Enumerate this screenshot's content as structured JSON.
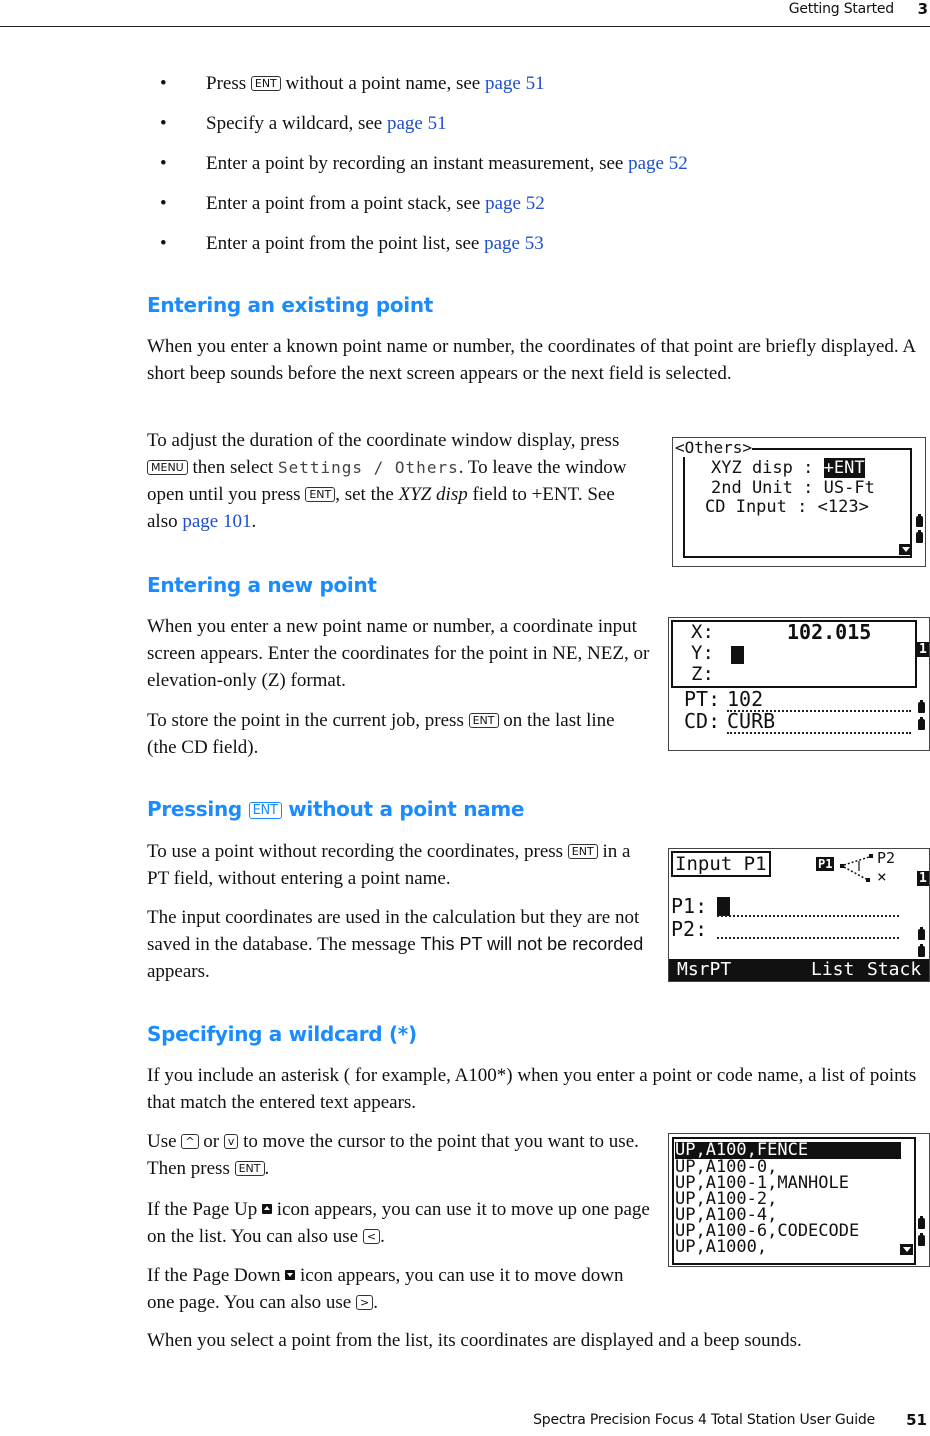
{
  "header": {
    "section": "Getting Started",
    "chapter": "3"
  },
  "footer": {
    "title": "Spectra Precision Focus 4 Total Station User Guide",
    "page": "51"
  },
  "bullets": [
    {
      "pre": "Press ",
      "key": "ENT",
      "post": " without a point name, see ",
      "link": "page 51"
    },
    {
      "pre": "Specify a wildcard, see ",
      "link": "page 51"
    },
    {
      "pre": "Enter a point by recording an instant measurement, see ",
      "link": "page 52"
    },
    {
      "pre": "Enter a point from a point stack, see ",
      "link": "page 52"
    },
    {
      "pre": "Enter a point from the point list, see ",
      "link": "page 53"
    }
  ],
  "sec1": {
    "heading": "Entering an existing point",
    "para1": "When you enter a known point name or number, the coordinates of that point are briefly displayed. A short beep sounds before the next screen appears or the next field is selected.",
    "para2_a": "To adjust the duration of the coordinate window display, press ",
    "key_menu": "MENU",
    "para2_b": " then select ",
    "menu_path": "Settings / Others",
    "para2_c": ". To leave the window open until you press ",
    "key_ent": "ENT",
    "para2_d": ", set the ",
    "field_name": "XYZ disp",
    "para2_e": " field to +ENT. See also ",
    "link": "page 101",
    "para2_f": ".",
    "screen": {
      "title": "<Others>",
      "rows": [
        {
          "label": "XYZ disp",
          "sep": ":",
          "value": "+ENT"
        },
        {
          "label": "2nd Unit",
          "sep": ":",
          "value": "US-Ft"
        },
        {
          "label": "CD Input",
          "sep": ":",
          "value": "<123>"
        }
      ]
    }
  },
  "sec2": {
    "heading": "Entering a new point",
    "para1": "When you enter a new point name or number, a coordinate input screen appears. Enter the coordinates for the point in NE, NEZ, or elevation-only (Z) format.",
    "para2_a": "To store the point in the current job, press ",
    "key": "ENT",
    "para2_b": " on the last line (the CD field).",
    "screen": {
      "x_label": "X:",
      "x_value": "102.015",
      "y_label": "Y:",
      "z_label": "Z:",
      "pt_label": "PT:",
      "pt_value": "102",
      "cd_label": "CD:",
      "cd_value": "CURB",
      "page_badge": "1"
    }
  },
  "sec3": {
    "heading_a": "Pressing ",
    "heading_key": "ENT",
    "heading_b": " without a point name",
    "para1_key": "ENT",
    "para1_a": "To use a point without recording the coordinates, press ",
    "para1_b": " in a PT field, without entering a point name.",
    "para2_a": "The input coordinates are used in the calculation but they are not saved in the database. The message ",
    "message": "This PT will not be recorded",
    "para2_b": " appears.",
    "screen": {
      "title": "Input P1",
      "diagram_p1": "P1",
      "diagram_p2": "P2",
      "diagram_x": "×",
      "page_badge": "1",
      "p1_label": "P1:",
      "p2_label": "P2:",
      "softkeys": [
        "MsrPT",
        "List",
        "Stack"
      ]
    }
  },
  "sec4": {
    "heading": "Specifying a wildcard (*)",
    "para1": "If you include an asterisk ( for example, A100*) when you enter a point or code name, a list of points that match the entered text appears.",
    "para2_a": "Use ",
    "key_up": "^",
    "para2_b": " or ",
    "key_down": "v",
    "para2_c": " to move the cursor to the point that you want to use. Then press ",
    "key_ent": "ENT",
    "para2_d": ".",
    "para3_a": "If the Page Up ",
    "para3_b": " icon appears, you can use it to move up one page on the list. You can also use ",
    "key_left": "<",
    "para3_c": ".",
    "para4_a": "If the Page Down ",
    "para4_b": " icon appears, you can use it to move down one page. You can also use ",
    "key_right": ">",
    "para4_c": ".",
    "para5": "When you select a point from the list, its coordinates are displayed and a beep sounds.",
    "screen": {
      "rows": [
        "UP,A100,FENCE",
        "UP,A100-0,",
        "UP,A100-1,MANHOLE",
        "UP,A100-2,",
        "UP,A100-4,",
        "UP,A100-6,CODECODE",
        "UP,A1000,"
      ]
    }
  }
}
